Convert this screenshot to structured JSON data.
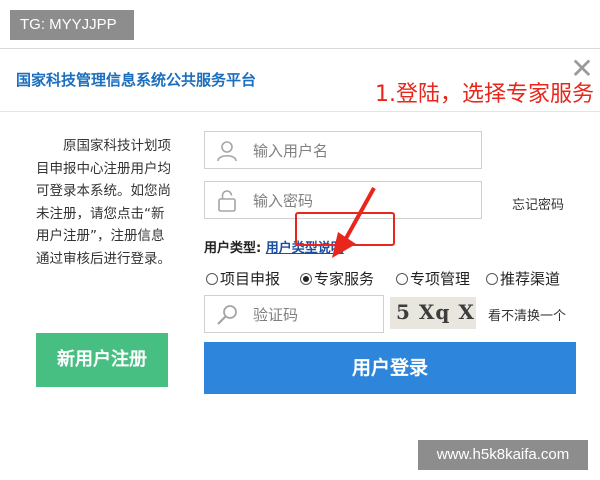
{
  "badge": {
    "text": "TG: MYYJJPP"
  },
  "dialog": {
    "title": "国家科技管理信息系统公共服务平台",
    "close": "✕"
  },
  "intro": {
    "text": "原国家科技计划项目申报中心注册用户均可登录本系统。如您尚未注册，请您点击“新用户注册”，注册信息通过审核后进行登录。"
  },
  "register": {
    "label": "新用户注册"
  },
  "form": {
    "username_placeholder": "输入用户名",
    "password_placeholder": "输入密码",
    "forgot": "忘记密码",
    "user_type_label": "用户类型:",
    "user_type_link": "用户类型说明",
    "radio_options": [
      "项目申报",
      "专家服务",
      "专项管理",
      "推荐渠道"
    ],
    "selected_option": "专家服务",
    "captcha_placeholder": "验证码",
    "captcha_text": "5 Xq X",
    "refresh": "看不清换一个",
    "login": "用户登录"
  },
  "annotation": {
    "text": "1.登陆，选择专家服务"
  },
  "watermark": {
    "text": "www.h5k8kaifa.com"
  },
  "colors": {
    "title_blue": "#1c6fbe",
    "login_blue": "#2d86db",
    "register_green": "#47bf83",
    "annotation_red": "#e8261c",
    "badge_gray": "#8d8d8d"
  },
  "icons": [
    "user-icon",
    "lock-icon",
    "search-icon",
    "close-icon",
    "arrow-icon"
  ]
}
